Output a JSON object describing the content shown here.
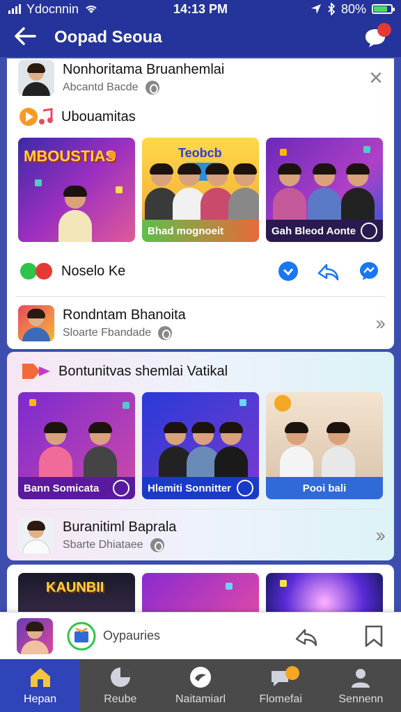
{
  "status": {
    "carrier": "Ydocnnin",
    "time": "14:13 PM",
    "battery": "80%",
    "battery_fraction": 0.8
  },
  "header": {
    "title": "Oopad Seoua",
    "badge_count": ""
  },
  "card1": {
    "profile": {
      "name": "Nonhoritama Bruanhemlai",
      "sub": "Abcantd Bacde"
    },
    "section": {
      "title": "Ubouamitas"
    },
    "thumbs": [
      {
        "banner": "MBOUSTIAS",
        "caption": ""
      },
      {
        "banner": "Teobcb",
        "caption": "Bhad mognoeit"
      },
      {
        "banner": "",
        "caption": "Gah Bleod Aonte"
      }
    ],
    "actions_label": "Noselo Ke",
    "item2": {
      "name": "Rondntam Bhanoita",
      "sub": "Sloarte Fbandade"
    }
  },
  "card2": {
    "section": {
      "title": "Bontunitvas shemlai Vatikal"
    },
    "thumbs": [
      {
        "caption": "Bann Somicata"
      },
      {
        "caption": "Hlemiti Sonnitter"
      },
      {
        "caption": "Pooi bali"
      }
    ],
    "item": {
      "name": "Buranitiml Baprala",
      "sub": "Sbarte Dhiataee"
    }
  },
  "card3": {
    "thumbs": [
      {
        "banner": "KAUNBII"
      },
      {
        "banner": ""
      },
      {
        "banner": ""
      }
    ]
  },
  "bottom_bar": {
    "label": "Oypauries"
  },
  "tabs": [
    {
      "label": "Hepan",
      "active": true
    },
    {
      "label": "Reube",
      "active": false
    },
    {
      "label": "Naitamiarl",
      "active": false
    },
    {
      "label": "Flomefai",
      "active": false
    },
    {
      "label": "Sennenn",
      "active": false
    }
  ],
  "colors": {
    "primary": "#24349a",
    "accent": "#2f44b8",
    "messenger": "#1877f2",
    "badge": "#e53935"
  }
}
